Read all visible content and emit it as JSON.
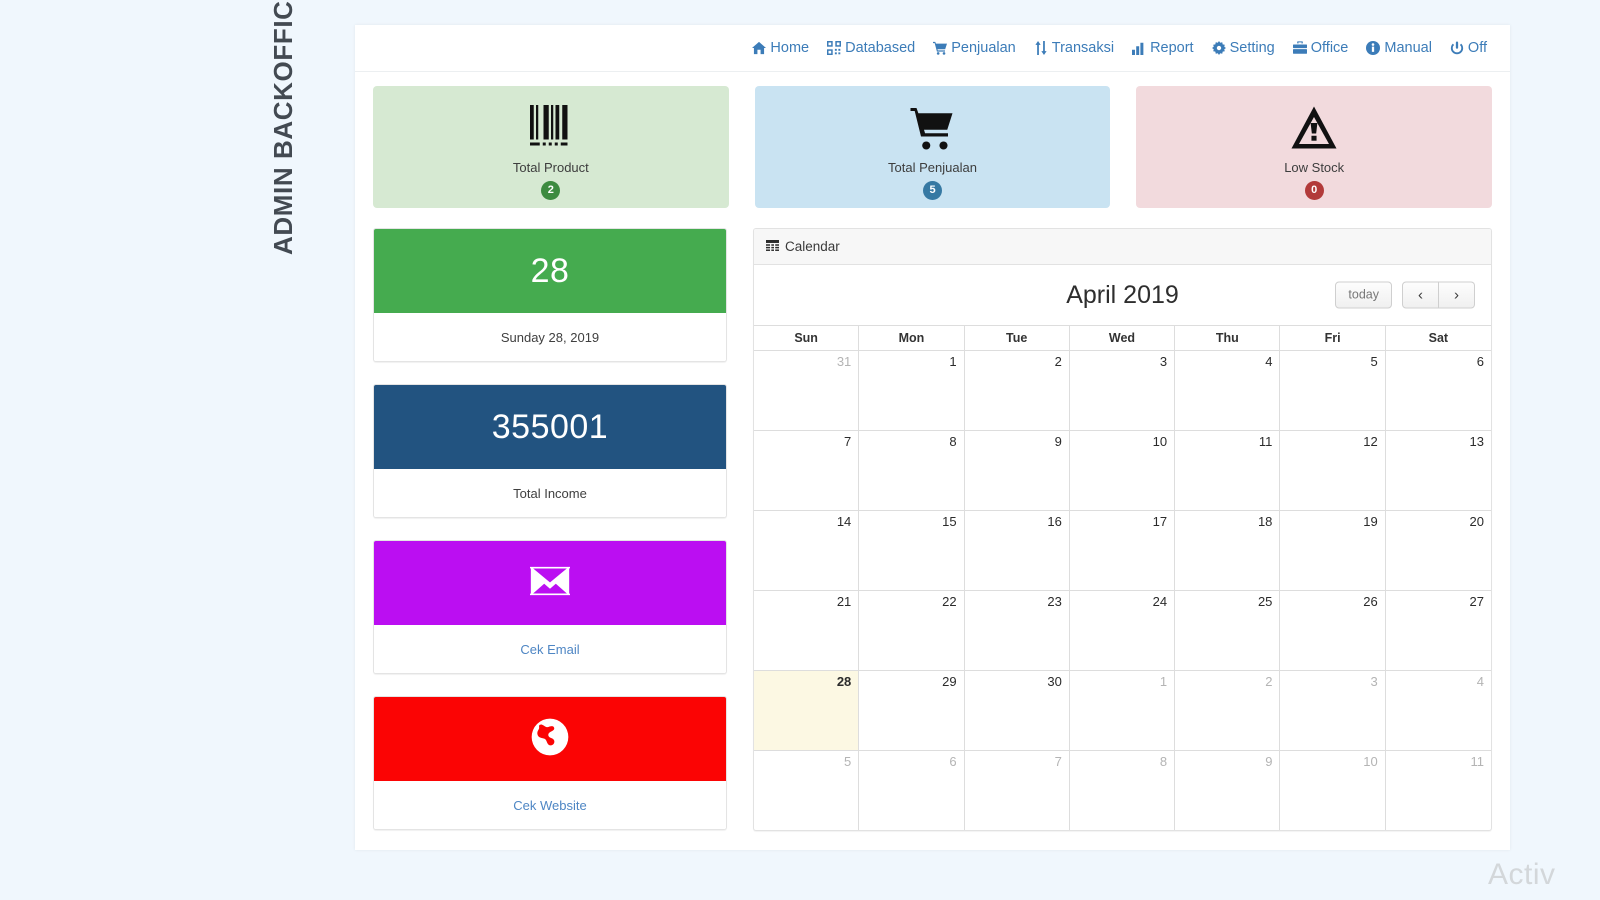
{
  "page": {
    "side_title": "ADMIN BACKOFFICE DASHBOARD",
    "background_color": "#f0f7fd",
    "watermark": "Activ"
  },
  "navbar": {
    "items": [
      {
        "label": "Home",
        "icon": "home-icon"
      },
      {
        "label": "Databased",
        "icon": "qrcode-icon"
      },
      {
        "label": "Penjualan",
        "icon": "cart-icon"
      },
      {
        "label": "Transaksi",
        "icon": "exchange-arrows-icon"
      },
      {
        "label": "Report",
        "icon": "bar-chart-icon"
      },
      {
        "label": "Setting",
        "icon": "gear-icon"
      },
      {
        "label": "Office",
        "icon": "briefcase-icon"
      },
      {
        "label": "Manual",
        "icon": "info-circle-icon"
      },
      {
        "label": "Off",
        "icon": "power-icon"
      }
    ],
    "link_color": "#3c7cb8"
  },
  "stats": [
    {
      "label": "Total Product",
      "badge": "2",
      "icon": "barcode-icon",
      "tile_color": "#d6e9d2",
      "badge_color": "#3d8b40"
    },
    {
      "label": "Total Penjualan",
      "badge": "5",
      "icon": "cart-icon",
      "tile_color": "#c9e3f2",
      "badge_color": "#3679a3"
    },
    {
      "label": "Low Stock",
      "badge": "0",
      "icon": "warning-icon",
      "tile_color": "#f2dadd",
      "badge_color": "#b23a3a"
    }
  ],
  "panels": [
    {
      "value": "28",
      "caption": "Sunday 28, 2019",
      "head_color": "#45ab4f",
      "is_link": false,
      "icon": null
    },
    {
      "value": "355001",
      "caption": "Total Income",
      "head_color": "#225380",
      "is_link": false,
      "icon": null
    },
    {
      "value": "",
      "caption": "Cek Email",
      "head_color": "#bb0ef2",
      "is_link": true,
      "icon": "envelope-icon"
    },
    {
      "value": "",
      "caption": "Cek Website",
      "head_color": "#fb0404",
      "is_link": true,
      "icon": "globe-icon"
    }
  ],
  "calendar": {
    "card_title": "Calendar",
    "card_icon": "calendar-icon",
    "month_title": "April 2019",
    "today_button": "today",
    "prev_button": "‹",
    "next_button": "›",
    "day_names": [
      "Sun",
      "Mon",
      "Tue",
      "Wed",
      "Thu",
      "Fri",
      "Sat"
    ],
    "today_highlight_color": "#fcf8e3",
    "weeks": [
      [
        {
          "d": "31",
          "o": true
        },
        {
          "d": "1",
          "o": false
        },
        {
          "d": "2",
          "o": false
        },
        {
          "d": "3",
          "o": false
        },
        {
          "d": "4",
          "o": false
        },
        {
          "d": "5",
          "o": false
        },
        {
          "d": "6",
          "o": false
        }
      ],
      [
        {
          "d": "7",
          "o": false
        },
        {
          "d": "8",
          "o": false
        },
        {
          "d": "9",
          "o": false
        },
        {
          "d": "10",
          "o": false
        },
        {
          "d": "11",
          "o": false
        },
        {
          "d": "12",
          "o": false
        },
        {
          "d": "13",
          "o": false
        }
      ],
      [
        {
          "d": "14",
          "o": false
        },
        {
          "d": "15",
          "o": false
        },
        {
          "d": "16",
          "o": false
        },
        {
          "d": "17",
          "o": false
        },
        {
          "d": "18",
          "o": false
        },
        {
          "d": "19",
          "o": false
        },
        {
          "d": "20",
          "o": false
        }
      ],
      [
        {
          "d": "21",
          "o": false
        },
        {
          "d": "22",
          "o": false
        },
        {
          "d": "23",
          "o": false
        },
        {
          "d": "24",
          "o": false
        },
        {
          "d": "25",
          "o": false
        },
        {
          "d": "26",
          "o": false
        },
        {
          "d": "27",
          "o": false
        }
      ],
      [
        {
          "d": "28",
          "o": false,
          "t": true
        },
        {
          "d": "29",
          "o": false
        },
        {
          "d": "30",
          "o": false
        },
        {
          "d": "1",
          "o": true
        },
        {
          "d": "2",
          "o": true
        },
        {
          "d": "3",
          "o": true
        },
        {
          "d": "4",
          "o": true
        }
      ],
      [
        {
          "d": "5",
          "o": true
        },
        {
          "d": "6",
          "o": true
        },
        {
          "d": "7",
          "o": true
        },
        {
          "d": "8",
          "o": true
        },
        {
          "d": "9",
          "o": true
        },
        {
          "d": "10",
          "o": true
        },
        {
          "d": "11",
          "o": true
        }
      ]
    ]
  }
}
